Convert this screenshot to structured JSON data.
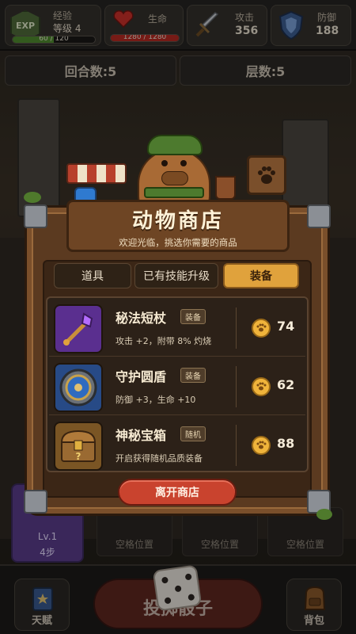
{
  "stats": {
    "exp_icon": "EXP",
    "exp_label": "经验",
    "level": "等级 4",
    "exp_bar": "60 / 120",
    "exp_progress": 0.5,
    "hp_label": "生命",
    "hp_bar": "1280 / 1280",
    "hp_progress": 1.0,
    "atk_label": "攻击",
    "atk_value": "356",
    "def_label": "防御",
    "def_value": "188"
  },
  "counters": {
    "rounds": "回合数:5",
    "floor": "层数:5"
  },
  "shop": {
    "title": "动物商店",
    "subtitle": "欢迎光临，挑选你需要的商品",
    "tabs": [
      "道具",
      "已有技能升级",
      "装备"
    ],
    "active_tab": "装备",
    "items": [
      {
        "name": "秘法短杖",
        "tag": "装备",
        "desc": "攻击 +2，附带 8% 灼烧",
        "price": "74",
        "icon": "staff-icon"
      },
      {
        "name": "守护圆盾",
        "tag": "装备",
        "desc": "防御 +3，生命 +10",
        "price": "62",
        "icon": "shield-icon"
      },
      {
        "name": "神秘宝箱",
        "tag": "随机",
        "desc": "开启获得随机品质装备",
        "price": "88",
        "icon": "chest-icon"
      }
    ],
    "leave_button": "离开商店"
  },
  "board": {
    "level_card_level": "Lv.1",
    "level_card_steps": "4步",
    "empty_slot": "空格位置"
  },
  "bottom": {
    "talent": "天赋",
    "roll": "投掷骰子",
    "bag": "背包"
  },
  "colors": {
    "accent_tab": "#e0a23c",
    "leave_button": "#c9432e",
    "coin": "#f0b43b"
  }
}
